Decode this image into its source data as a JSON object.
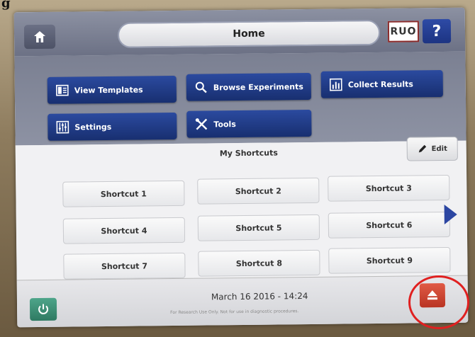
{
  "header": {
    "title": "Home",
    "ruo_badge": "RUO",
    "help_label": "?"
  },
  "nav": {
    "view_templates": "View Templates",
    "browse_experiments": "Browse Experiments",
    "collect_results": "Collect Results",
    "settings": "Settings",
    "tools": "Tools"
  },
  "shortcuts": {
    "title": "My Shortcuts",
    "edit_label": "Edit",
    "items": [
      "Shortcut 1",
      "Shortcut 2",
      "Shortcut 3",
      "Shortcut 4",
      "Shortcut 5",
      "Shortcut 6",
      "Shortcut 7",
      "Shortcut 8",
      "Shortcut 9"
    ]
  },
  "footer": {
    "datetime": "March 16 2016 - 14:24",
    "notice": "For Research Use Only. Not for use in diagnostic procedures."
  },
  "stray_text": "g",
  "colors": {
    "nav_button": "#1f3a88",
    "eject": "#c8402e",
    "power": "#3a8f73",
    "highlight_circle": "#e02020"
  },
  "icons": [
    "home-icon",
    "templates-icon",
    "search-icon",
    "results-icon",
    "settings-sliders-icon",
    "tools-icon",
    "pencil-icon",
    "chevron-right-icon",
    "power-icon",
    "eject-icon"
  ]
}
